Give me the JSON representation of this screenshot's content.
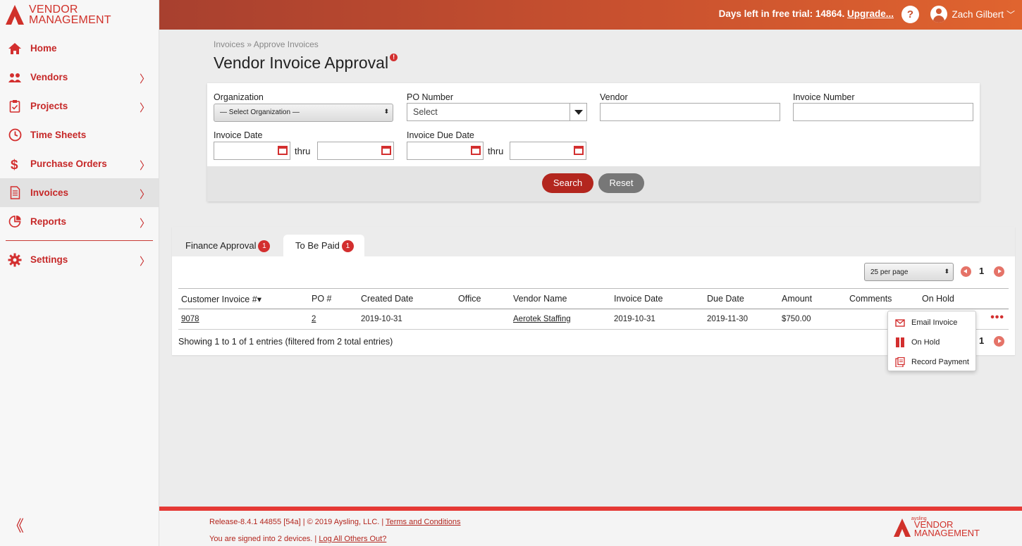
{
  "app": {
    "logo_line1": "VENDOR",
    "logo_line2": "MANAGEMENT",
    "brand_color": "#d0312a"
  },
  "sidebar": {
    "items": [
      {
        "label": "Home",
        "icon": "home-icon",
        "has_submenu": false
      },
      {
        "label": "Vendors",
        "icon": "users-icon",
        "has_submenu": true
      },
      {
        "label": "Projects",
        "icon": "clipboard-icon",
        "has_submenu": true
      },
      {
        "label": "Time Sheets",
        "icon": "clock-icon",
        "has_submenu": false
      },
      {
        "label": "Purchase Orders",
        "icon": "dollar-icon",
        "has_submenu": true
      },
      {
        "label": "Invoices",
        "icon": "invoice-icon",
        "has_submenu": true,
        "active": true
      },
      {
        "label": "Reports",
        "icon": "reports-icon",
        "has_submenu": true
      },
      {
        "label": "Settings",
        "icon": "gear-icon",
        "has_submenu": true
      }
    ],
    "chevron": "〉",
    "collapse": "《"
  },
  "header": {
    "trial_text": "Days left in free trial: 14864.",
    "upgrade_link": "Upgrade...",
    "help": "?",
    "user_name": "Zach Gilbert",
    "user_chevron": "﹀"
  },
  "page": {
    "breadcrumb": "Invoices » Approve Invoices",
    "title": "Vendor Invoice Approval",
    "info_badge": "!"
  },
  "filters": {
    "organization_label": "Organization",
    "organization_value": "— Select Organization —",
    "po_label": "PO Number",
    "po_value": "Select",
    "vendor_label": "Vendor",
    "vendor_value": "",
    "invoice_number_label": "Invoice Number",
    "invoice_number_value": "",
    "invoice_date_label": "Invoice Date",
    "invoice_due_date_label": "Invoice Due Date",
    "thru": "thru",
    "search_button": "Search",
    "reset_button": "Reset"
  },
  "tabs": [
    {
      "label": "Finance Approval",
      "count": "1",
      "active": false
    },
    {
      "label": "To Be Paid",
      "count": "1",
      "active": true
    }
  ],
  "pagination": {
    "per_page": "25 per page",
    "current_page": "1"
  },
  "table": {
    "headers": [
      "Customer Invoice #",
      "PO #",
      "Created Date",
      "Office",
      "Vendor Name",
      "Invoice Date",
      "Due Date",
      "Amount",
      "Comments",
      "On Hold"
    ],
    "sort_indicator": "▾",
    "rows": [
      {
        "invoice": "9078",
        "po": "2",
        "created": "2019-10-31",
        "office": "",
        "vendor": "Aerotek Staffing",
        "invoice_date": "2019-10-31",
        "due_date": "2019-11-30",
        "amount": "$750.00",
        "comments": "",
        "on_hold": ""
      }
    ],
    "more_actions": "•••",
    "showing": "Showing 1 to 1 of 1 entries (filtered from 2 total entries)"
  },
  "context_menu": {
    "items": [
      {
        "label": "Email Invoice",
        "icon": "email-icon"
      },
      {
        "label": "On Hold",
        "icon": "pause-icon"
      },
      {
        "label": "Record Payment",
        "icon": "payment-icon"
      }
    ]
  },
  "footer": {
    "release": "Release-8.4.1 44855 [54a] | © 2019 Aysling, LLC. |",
    "terms_link": "Terms and Conditions",
    "signed_in": "You are signed into 2 devices. |",
    "logout_link": "Log All Others Out?",
    "logo_small": "aysling",
    "logo_line1": "VENDOR",
    "logo_line2": "MANAGEMENT"
  }
}
